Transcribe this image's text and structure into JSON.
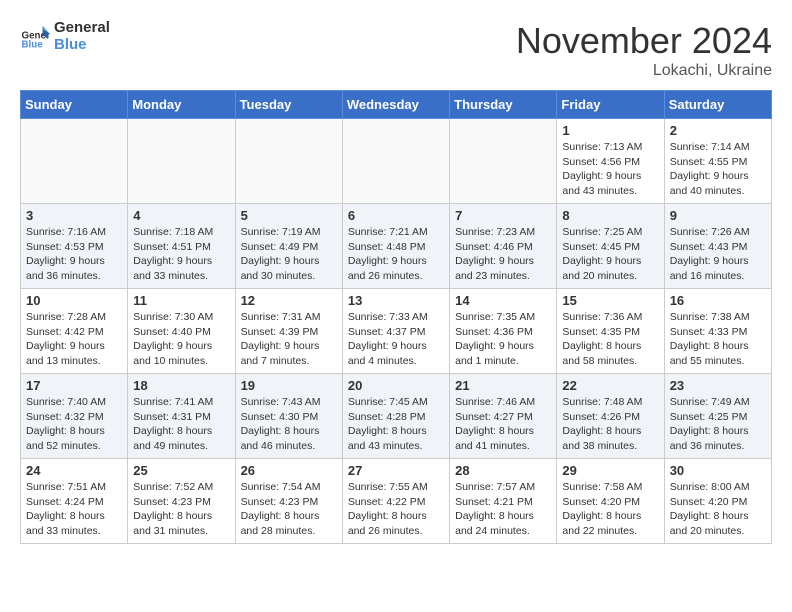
{
  "logo": {
    "line1": "General",
    "line2": "Blue"
  },
  "title": "November 2024",
  "location": "Lokachi, Ukraine",
  "days_of_week": [
    "Sunday",
    "Monday",
    "Tuesday",
    "Wednesday",
    "Thursday",
    "Friday",
    "Saturday"
  ],
  "weeks": [
    [
      {
        "day": "",
        "info": ""
      },
      {
        "day": "",
        "info": ""
      },
      {
        "day": "",
        "info": ""
      },
      {
        "day": "",
        "info": ""
      },
      {
        "day": "",
        "info": ""
      },
      {
        "day": "1",
        "info": "Sunrise: 7:13 AM\nSunset: 4:56 PM\nDaylight: 9 hours\nand 43 minutes."
      },
      {
        "day": "2",
        "info": "Sunrise: 7:14 AM\nSunset: 4:55 PM\nDaylight: 9 hours\nand 40 minutes."
      }
    ],
    [
      {
        "day": "3",
        "info": "Sunrise: 7:16 AM\nSunset: 4:53 PM\nDaylight: 9 hours\nand 36 minutes."
      },
      {
        "day": "4",
        "info": "Sunrise: 7:18 AM\nSunset: 4:51 PM\nDaylight: 9 hours\nand 33 minutes."
      },
      {
        "day": "5",
        "info": "Sunrise: 7:19 AM\nSunset: 4:49 PM\nDaylight: 9 hours\nand 30 minutes."
      },
      {
        "day": "6",
        "info": "Sunrise: 7:21 AM\nSunset: 4:48 PM\nDaylight: 9 hours\nand 26 minutes."
      },
      {
        "day": "7",
        "info": "Sunrise: 7:23 AM\nSunset: 4:46 PM\nDaylight: 9 hours\nand 23 minutes."
      },
      {
        "day": "8",
        "info": "Sunrise: 7:25 AM\nSunset: 4:45 PM\nDaylight: 9 hours\nand 20 minutes."
      },
      {
        "day": "9",
        "info": "Sunrise: 7:26 AM\nSunset: 4:43 PM\nDaylight: 9 hours\nand 16 minutes."
      }
    ],
    [
      {
        "day": "10",
        "info": "Sunrise: 7:28 AM\nSunset: 4:42 PM\nDaylight: 9 hours\nand 13 minutes."
      },
      {
        "day": "11",
        "info": "Sunrise: 7:30 AM\nSunset: 4:40 PM\nDaylight: 9 hours\nand 10 minutes."
      },
      {
        "day": "12",
        "info": "Sunrise: 7:31 AM\nSunset: 4:39 PM\nDaylight: 9 hours\nand 7 minutes."
      },
      {
        "day": "13",
        "info": "Sunrise: 7:33 AM\nSunset: 4:37 PM\nDaylight: 9 hours\nand 4 minutes."
      },
      {
        "day": "14",
        "info": "Sunrise: 7:35 AM\nSunset: 4:36 PM\nDaylight: 9 hours\nand 1 minute."
      },
      {
        "day": "15",
        "info": "Sunrise: 7:36 AM\nSunset: 4:35 PM\nDaylight: 8 hours\nand 58 minutes."
      },
      {
        "day": "16",
        "info": "Sunrise: 7:38 AM\nSunset: 4:33 PM\nDaylight: 8 hours\nand 55 minutes."
      }
    ],
    [
      {
        "day": "17",
        "info": "Sunrise: 7:40 AM\nSunset: 4:32 PM\nDaylight: 8 hours\nand 52 minutes."
      },
      {
        "day": "18",
        "info": "Sunrise: 7:41 AM\nSunset: 4:31 PM\nDaylight: 8 hours\nand 49 minutes."
      },
      {
        "day": "19",
        "info": "Sunrise: 7:43 AM\nSunset: 4:30 PM\nDaylight: 8 hours\nand 46 minutes."
      },
      {
        "day": "20",
        "info": "Sunrise: 7:45 AM\nSunset: 4:28 PM\nDaylight: 8 hours\nand 43 minutes."
      },
      {
        "day": "21",
        "info": "Sunrise: 7:46 AM\nSunset: 4:27 PM\nDaylight: 8 hours\nand 41 minutes."
      },
      {
        "day": "22",
        "info": "Sunrise: 7:48 AM\nSunset: 4:26 PM\nDaylight: 8 hours\nand 38 minutes."
      },
      {
        "day": "23",
        "info": "Sunrise: 7:49 AM\nSunset: 4:25 PM\nDaylight: 8 hours\nand 36 minutes."
      }
    ],
    [
      {
        "day": "24",
        "info": "Sunrise: 7:51 AM\nSunset: 4:24 PM\nDaylight: 8 hours\nand 33 minutes."
      },
      {
        "day": "25",
        "info": "Sunrise: 7:52 AM\nSunset: 4:23 PM\nDaylight: 8 hours\nand 31 minutes."
      },
      {
        "day": "26",
        "info": "Sunrise: 7:54 AM\nSunset: 4:23 PM\nDaylight: 8 hours\nand 28 minutes."
      },
      {
        "day": "27",
        "info": "Sunrise: 7:55 AM\nSunset: 4:22 PM\nDaylight: 8 hours\nand 26 minutes."
      },
      {
        "day": "28",
        "info": "Sunrise: 7:57 AM\nSunset: 4:21 PM\nDaylight: 8 hours\nand 24 minutes."
      },
      {
        "day": "29",
        "info": "Sunrise: 7:58 AM\nSunset: 4:20 PM\nDaylight: 8 hours\nand 22 minutes."
      },
      {
        "day": "30",
        "info": "Sunrise: 8:00 AM\nSunset: 4:20 PM\nDaylight: 8 hours\nand 20 minutes."
      }
    ]
  ]
}
